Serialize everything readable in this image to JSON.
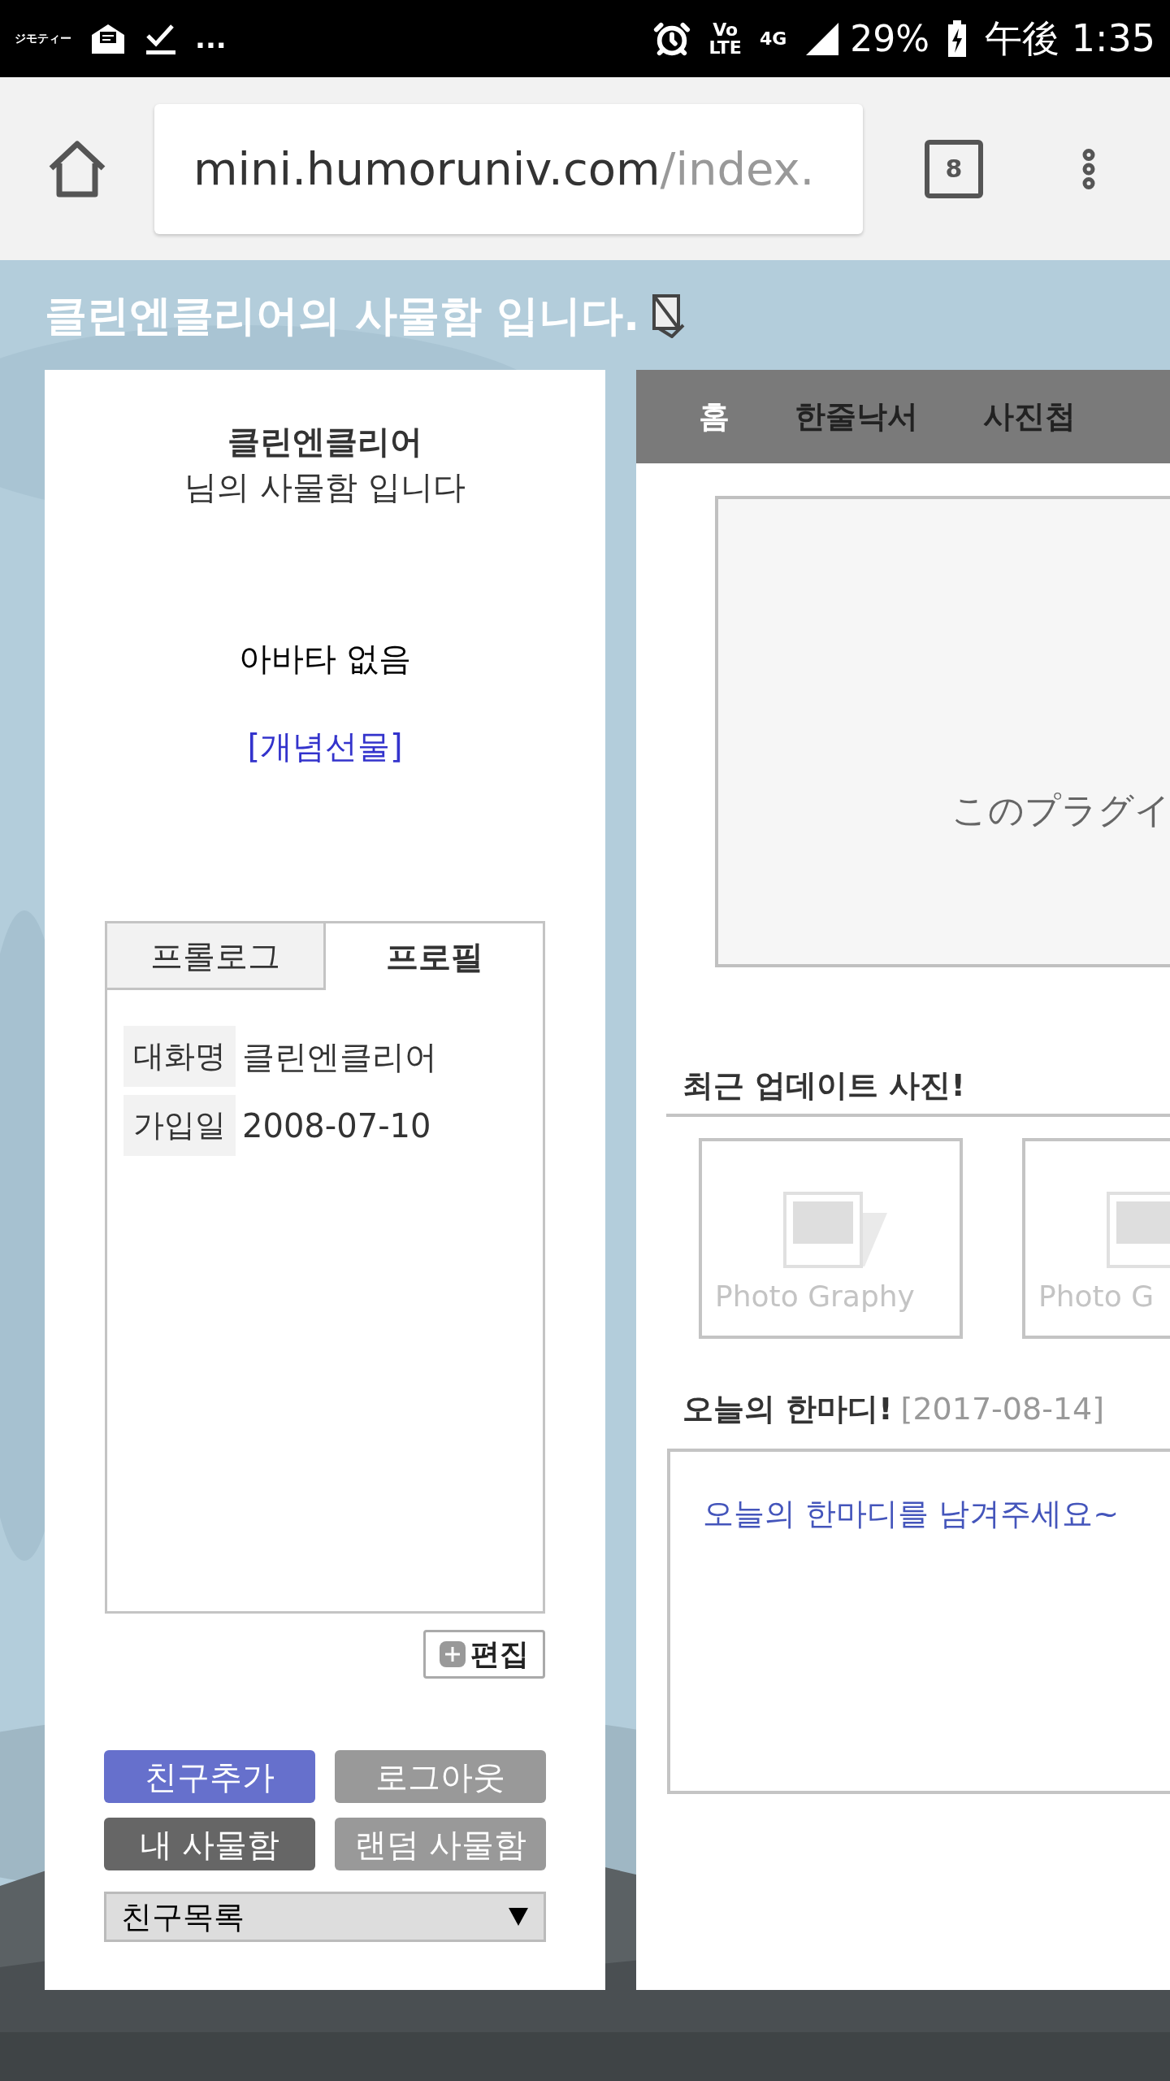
{
  "status_bar": {
    "app_label": "ジモティー",
    "more": "...",
    "volte": [
      "Vo",
      "LTE"
    ],
    "network": "4G",
    "battery": "29%",
    "time": "午後 1:35"
  },
  "browser": {
    "url_host": "mini.humoruniv.com",
    "url_path": "/index.",
    "tab_count": "8"
  },
  "page_title": "클린엔클리어의 사물함 입니다.",
  "profile": {
    "name": "클린엔클리어",
    "subtitle": "님의 사물함 입니다",
    "avatar": "아바타 없음",
    "gift_link": "[개념선물]",
    "tabs": [
      {
        "label": "프롤로그",
        "selected": false
      },
      {
        "label": "프로필",
        "selected": true
      }
    ],
    "fields": [
      {
        "label": "대화명",
        "value": "클린엔클리어"
      },
      {
        "label": "가입일",
        "value": "2008-07-10"
      }
    ],
    "edit_button": "편집",
    "buttons": [
      {
        "label": "친구추가",
        "color": "#6670cc"
      },
      {
        "label": "로그아웃",
        "color": "#999999"
      },
      {
        "label": "내 사물함",
        "color": "#666666"
      },
      {
        "label": "랜덤 사물함",
        "color": "#999999"
      }
    ],
    "friends_select": "친구목록"
  },
  "nav": [
    {
      "label": "홈",
      "selected": true
    },
    {
      "label": "한줄낙서",
      "selected": false
    },
    {
      "label": "사진첩",
      "selected": false
    }
  ],
  "plugin": {
    "message": "このプラグイ"
  },
  "recent_photos": {
    "title": "최근 업데이트 사진!",
    "items": [
      {
        "caption": "Photo Graphy"
      },
      {
        "caption": "Photo G"
      }
    ]
  },
  "today": {
    "title": "오늘의 한마디!",
    "date": "[2017-08-14]",
    "prompt": "오늘의 한마디를 남겨주세요~"
  }
}
